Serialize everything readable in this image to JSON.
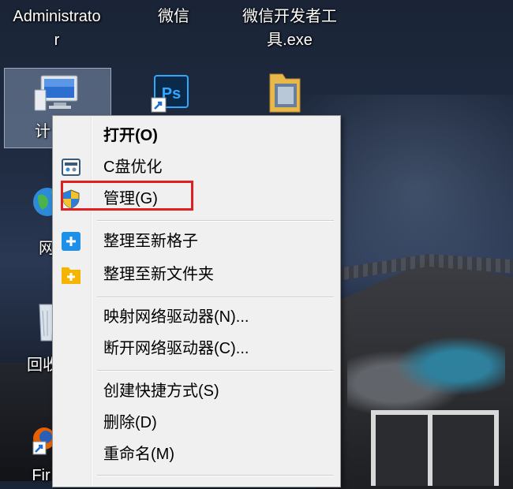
{
  "desktop": {
    "icons": [
      {
        "label_line1": "Administrato",
        "label_line2": "r",
        "icon": "administrator-folder-icon"
      },
      {
        "label_line1": "微信",
        "icon": "wechat-icon"
      },
      {
        "label_line1": "微信开发者工",
        "label_line2": "具.exe",
        "icon": "wechat-devtools-icon"
      },
      {
        "label_partial": "计",
        "icon": "computer-icon"
      },
      {
        "label_partial": "Ps",
        "icon": "photoshop-shortcut-icon"
      },
      {
        "icon": "folder-icon"
      },
      {
        "label_partial": "网",
        "icon": "network-globe-icon"
      },
      {
        "label_partial": "回收",
        "icon": "recycle-bin-icon"
      },
      {
        "label_partial": "Fir",
        "icon": "firefox-icon"
      }
    ]
  },
  "context_menu": {
    "items": [
      {
        "label": "打开(O)",
        "bold": true
      },
      {
        "label": "C盘优化",
        "icon": "disk-optimize-icon"
      },
      {
        "label": "管理(G)",
        "icon": "uac-shield-icon",
        "highlighted": true
      },
      {
        "label": "整理至新格子",
        "icon": "plus-blue-icon"
      },
      {
        "label": "整理至新文件夹",
        "icon": "plus-folder-icon"
      },
      {
        "label": "映射网络驱动器(N)..."
      },
      {
        "label": "断开网络驱动器(C)..."
      },
      {
        "label": "创建快捷方式(S)"
      },
      {
        "label": "删除(D)"
      },
      {
        "label": "重命名(M)"
      }
    ]
  },
  "colors": {
    "highlight_border": "#e02020",
    "menu_bg": "#f0f0f0"
  }
}
